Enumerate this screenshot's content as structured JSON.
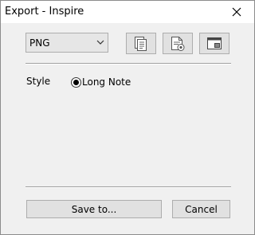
{
  "window": {
    "title": "Export - Inspire"
  },
  "toolbar": {
    "format_value": "PNG",
    "icons": [
      "copy-pages-icon",
      "note-export-icon",
      "window-export-icon"
    ]
  },
  "style_section": {
    "label": "Style",
    "options": [
      {
        "label": "Long Note",
        "selected": true
      }
    ]
  },
  "footer": {
    "save_label": "Save to...",
    "cancel_label": "Cancel"
  },
  "colors": {
    "window_bg": "#f0f0f0",
    "button_bg": "#e1e1e1",
    "border": "#adadad"
  }
}
